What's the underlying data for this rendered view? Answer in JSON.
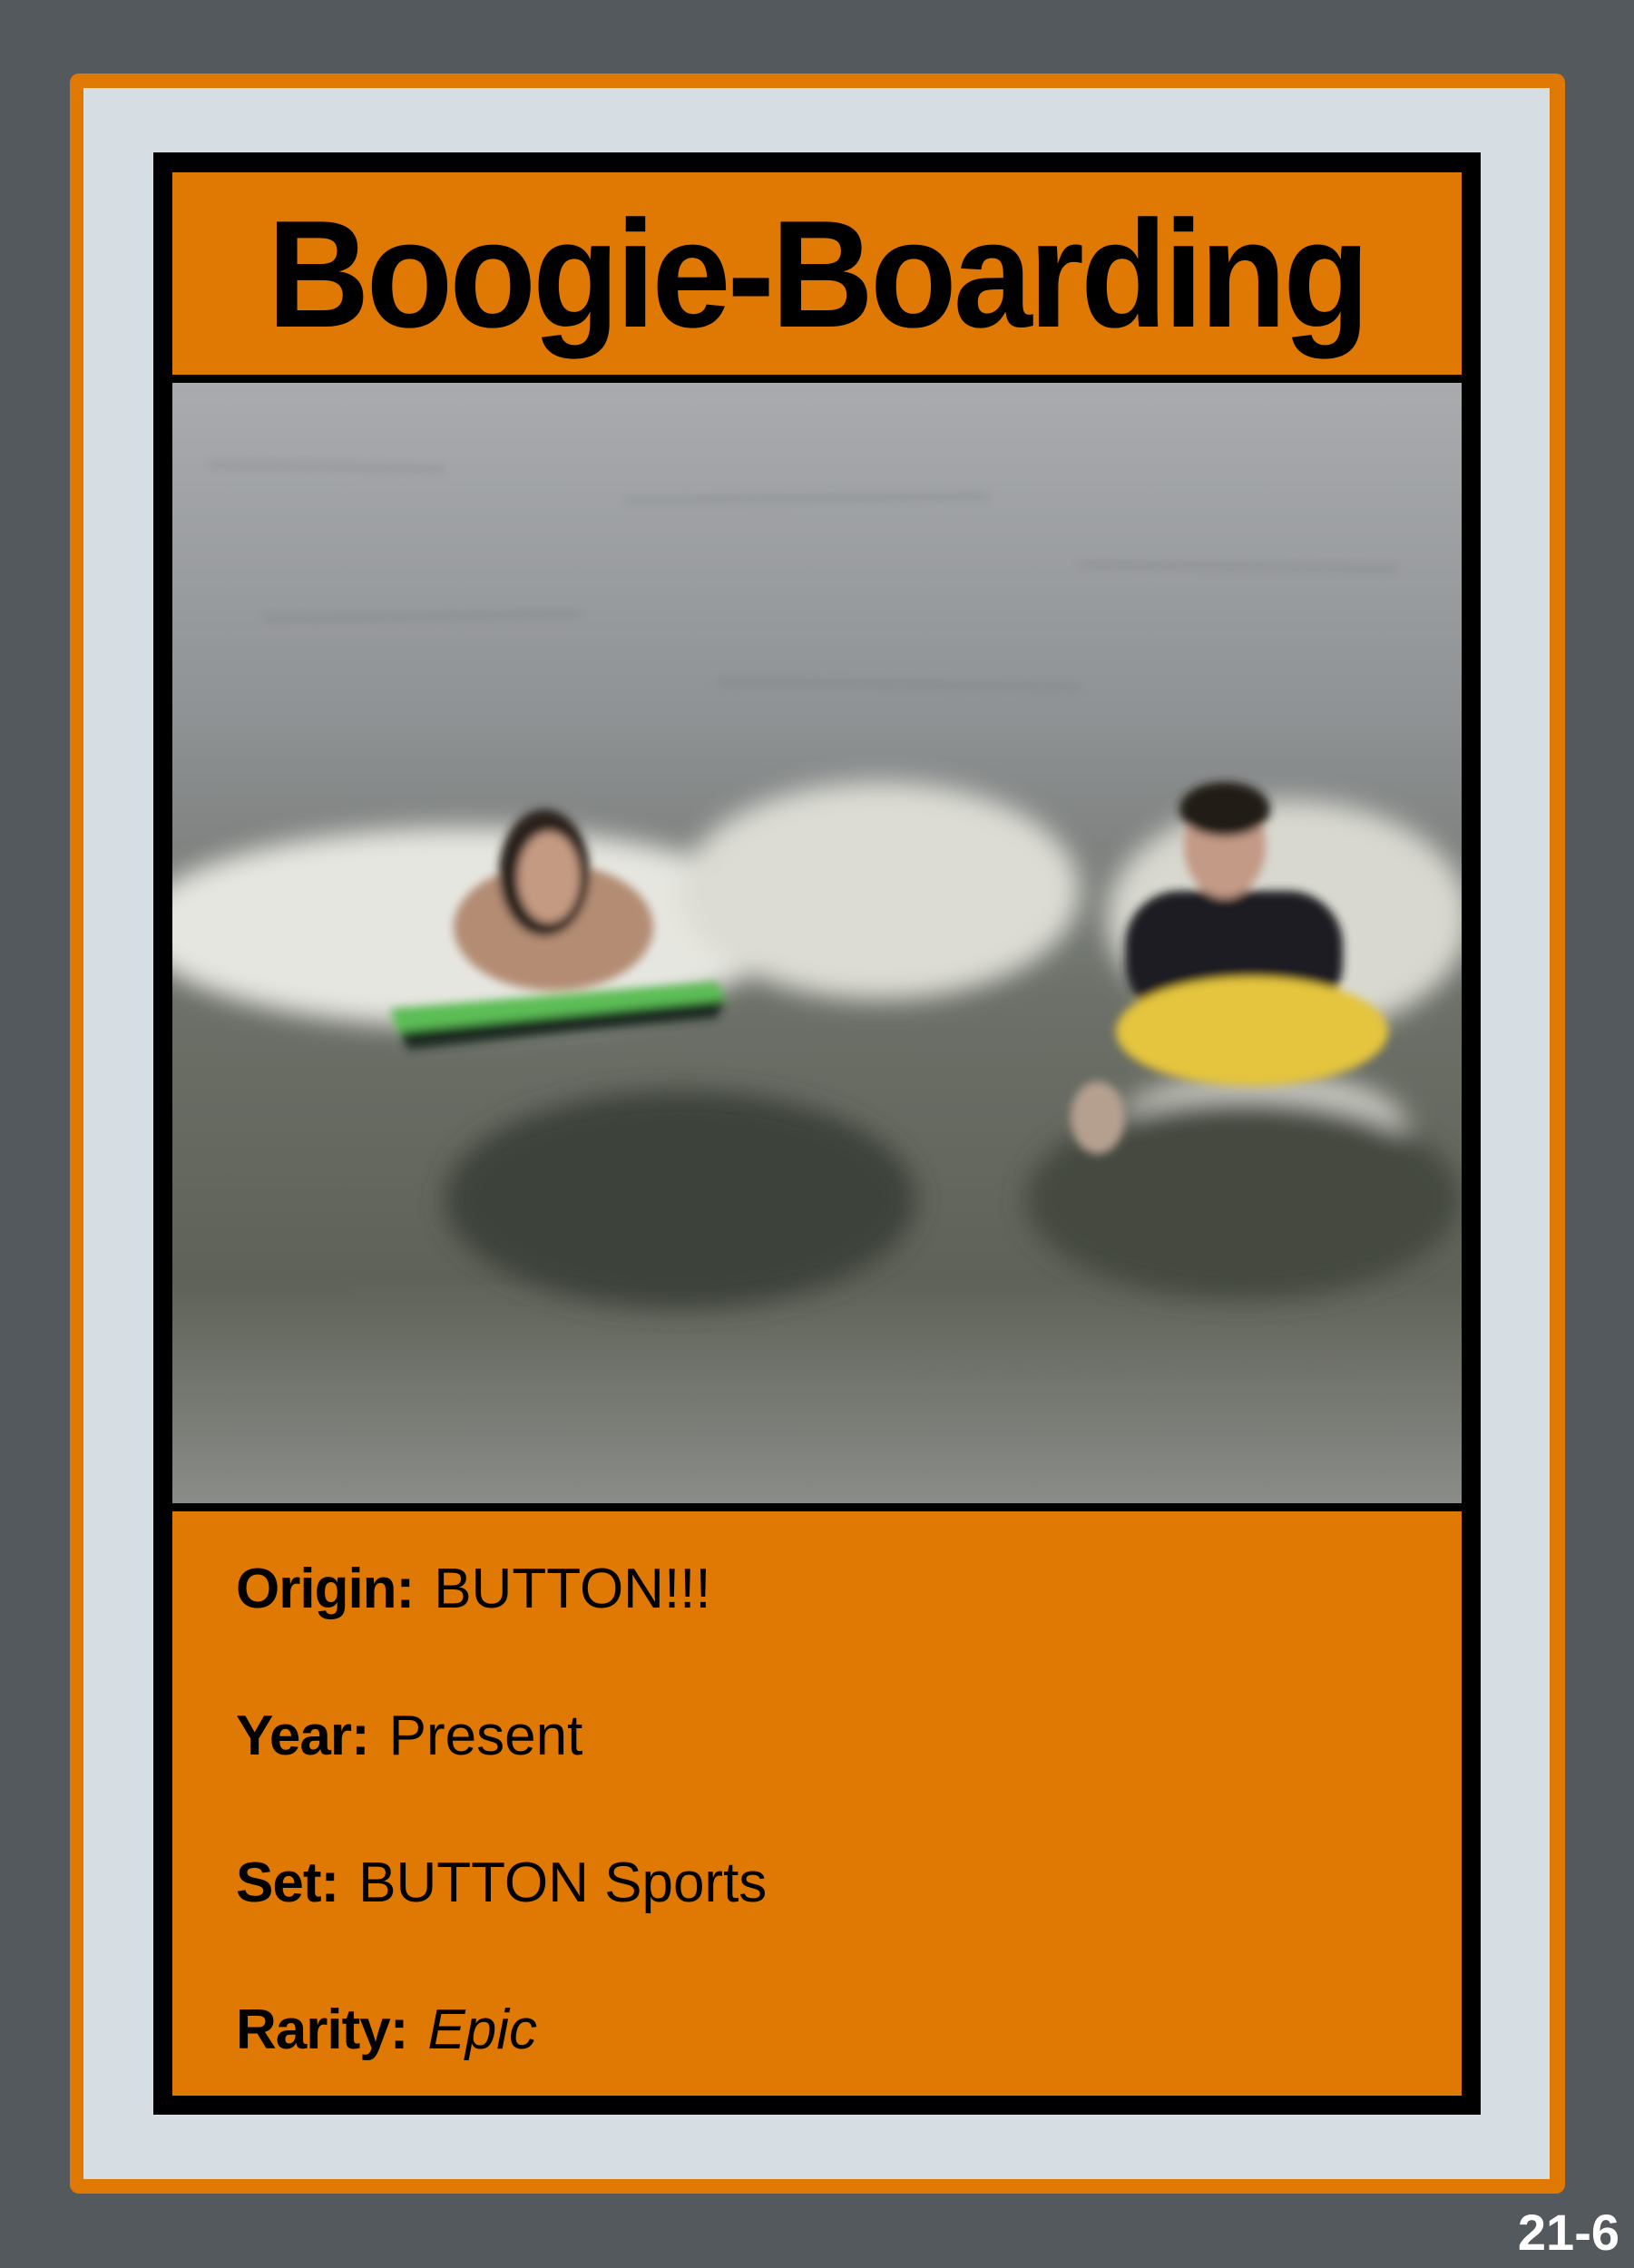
{
  "card": {
    "title": "Boogie-Boarding",
    "stats": [
      {
        "label": "Origin:",
        "value": "BUTTON!!!"
      },
      {
        "label": "Year:",
        "value": "Present"
      },
      {
        "label": "Set:",
        "value": "BUTTON Sports"
      },
      {
        "label": "Rarity:",
        "value": "Epic"
      }
    ],
    "card_number": "21-6"
  },
  "colors": {
    "accent": "#e07804",
    "background": "#53595c",
    "inner": "#d6dde3",
    "frame": "#000000"
  }
}
